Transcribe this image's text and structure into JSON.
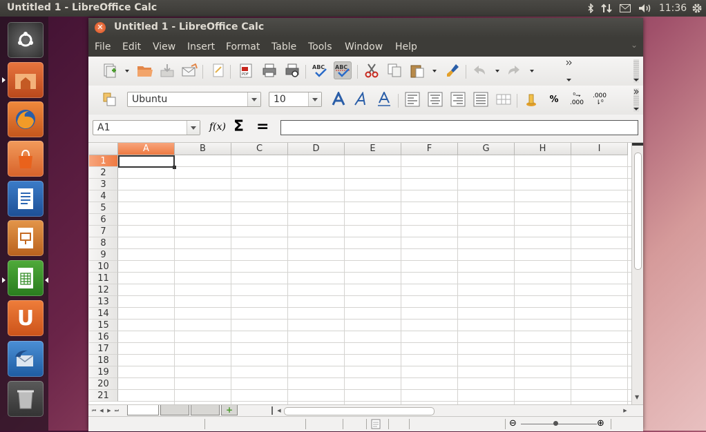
{
  "top_panel": {
    "title": "Untitled 1 - LibreOffice Calc",
    "time": "11:36",
    "icons": [
      "bluetooth-icon",
      "network-icon",
      "mail-icon",
      "volume-icon",
      "gear-icon"
    ]
  },
  "launcher": {
    "items": [
      "dash-home",
      "files",
      "firefox",
      "ubuntu-software-center",
      "libreoffice-writer",
      "libreoffice-impress",
      "libreoffice-calc",
      "ubuntu-one",
      "thunderbird",
      "trash"
    ]
  },
  "window": {
    "title": "Untitled 1 - LibreOffice Calc",
    "menu": [
      "File",
      "Edit",
      "View",
      "Insert",
      "Format",
      "Table",
      "Tools",
      "Window",
      "Help"
    ]
  },
  "formatting": {
    "font_name": "Ubuntu",
    "font_size": "10",
    "percent_label": "%",
    "add_decimal_label": ".000",
    "del_decimal_label": ".000"
  },
  "formula_bar": {
    "name_box": "A1",
    "function_wizard": "f(x)",
    "sum_symbol": "Σ",
    "equals_symbol": "=",
    "content": ""
  },
  "sheet": {
    "columns": [
      "A",
      "B",
      "C",
      "D",
      "E",
      "F",
      "G",
      "H",
      "I"
    ],
    "rows": [
      "1",
      "2",
      "3",
      "4",
      "5",
      "6",
      "7",
      "8",
      "9",
      "10",
      "11",
      "12",
      "13",
      "14",
      "15",
      "16",
      "17",
      "18",
      "19",
      "20",
      "21"
    ],
    "active_cell": "A1"
  },
  "colors": {
    "accent": "#ef7a42",
    "panel": "#3d3c38"
  }
}
